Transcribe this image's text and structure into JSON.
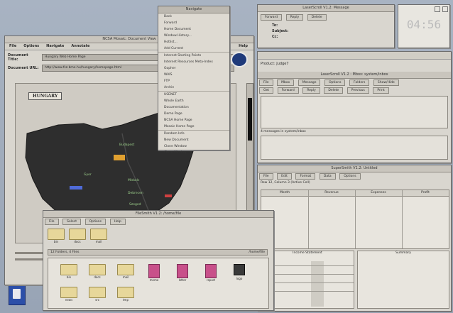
{
  "browser": {
    "title": "NCSA Mosaic: Document View",
    "menu": [
      "File",
      "Options",
      "Navigate",
      "Annotate",
      "Help"
    ],
    "doc_title_label": "Document Title:",
    "doc_title_value": "Hungary Web Home Page",
    "doc_url_label": "Document URL:",
    "doc_url_value": "http://www.fsz.bme.hu/hungary/homepage.html",
    "map_heading": "HUNGARY",
    "map_labels": [
      "Budapest",
      "Gyor",
      "Miskolc",
      "Debrecen",
      "Szeged",
      "Pecs"
    ],
    "map_red_label": "Szeged"
  },
  "dropdown": {
    "header": "Navigate",
    "items": [
      "Back",
      "Forward",
      "Home Document",
      "Window History...",
      "Hotlist...",
      "Add Current",
      "Internet Starting Points",
      "Internet Resources Meta-Index",
      "Gopher",
      "WAIS",
      "FTP",
      "Archie",
      "USENET",
      "Whole Earth",
      "Documentation",
      "Demo Page",
      "NCSA Home Page",
      "Mosaic Home Page",
      "Random Info",
      "New Document",
      "Clone Window",
      "Close Window"
    ]
  },
  "mail": {
    "title": "LaserScroll V1.2: Message",
    "buttons": [
      "Forward",
      "Reply",
      "Delete"
    ],
    "to_label": "To:",
    "subject_label": "Subject:",
    "cc_label": "Cc:",
    "body_text": "Product: Judge7"
  },
  "mailer": {
    "title": "LaserScroll V1.2 : Mbox: system/inbox",
    "toolbar1": [
      "File",
      "Mbox",
      "Message",
      "Options",
      "Folders",
      "Show/Hide"
    ],
    "toolbar2": [
      "Get",
      "Forward",
      "Reply",
      "Delete",
      "Previous",
      "Print"
    ],
    "status": "4 messages in system/inbox"
  },
  "spreadsheet": {
    "title": "SuperSmith V1.2: Untitled",
    "toolbar": [
      "File",
      "Edit",
      "Format",
      "Data",
      "Options"
    ],
    "status": "Row 12, Column 3 (Active Cell)",
    "col_headers": [
      "Month",
      "Revenue",
      "Expenses",
      "Profit"
    ],
    "panel_a": "Income Statement",
    "panel_b": "Summary"
  },
  "filemgr": {
    "title": "FileSmith V1.2: /home/file",
    "toolbar": [
      "File",
      "Select",
      "Options",
      "Help"
    ],
    "path_label": "12 Folders, 4 Files",
    "path_right": "/home/file",
    "folders_top": [
      "bin",
      "docs",
      "mail"
    ],
    "items": [
      {
        "kind": "folder",
        "name": "bin"
      },
      {
        "kind": "folder",
        "name": "docs"
      },
      {
        "kind": "folder",
        "name": "mail"
      },
      {
        "kind": "doc",
        "name": "memo"
      },
      {
        "kind": "doc",
        "name": "letter"
      },
      {
        "kind": "doc",
        "name": "report"
      },
      {
        "kind": "special",
        "name": "logo"
      },
      {
        "kind": "folder",
        "name": "news"
      },
      {
        "kind": "folder",
        "name": "src"
      },
      {
        "kind": "folder",
        "name": "tmp"
      }
    ]
  },
  "clock": {
    "time": "04:56"
  },
  "colors": {
    "accent": "#2c4fa8",
    "folder": "#e7d79a",
    "doc": "#c8508a",
    "map": "#2e2e2e"
  }
}
